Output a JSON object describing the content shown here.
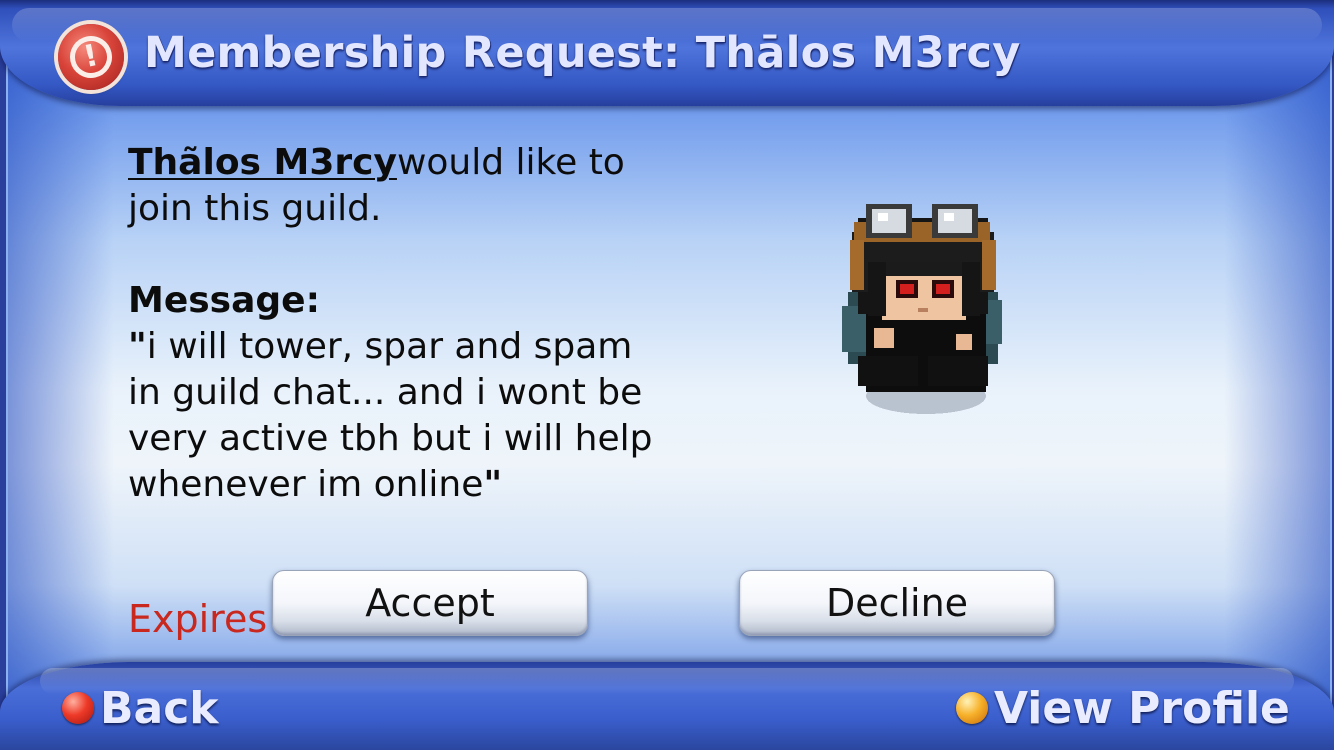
{
  "dialog": {
    "title": "Membership Request: Thālos M3rcy",
    "alert_icon": "alert-icon"
  },
  "request": {
    "player_name": "Thãlos M3rcy",
    "text_after_name": "would like to join this guild."
  },
  "message": {
    "label": "Message:",
    "open_quote": "\"",
    "body": "i will tower, spar and spam in guild chat... and i wont be very active tbh but i will help whenever im online",
    "close_quote": "\""
  },
  "expires_label": "Expires",
  "buttons": {
    "accept": "Accept",
    "decline": "Decline"
  },
  "footer": {
    "back": "Back",
    "back_icon_color": "#e8392b",
    "view_profile": "View Profile",
    "view_profile_icon_color": "#f5a623"
  },
  "colors": {
    "frame_blue": "#3a5ecc",
    "title_text": "#e2e6ff",
    "expires_red": "#c8281e"
  }
}
